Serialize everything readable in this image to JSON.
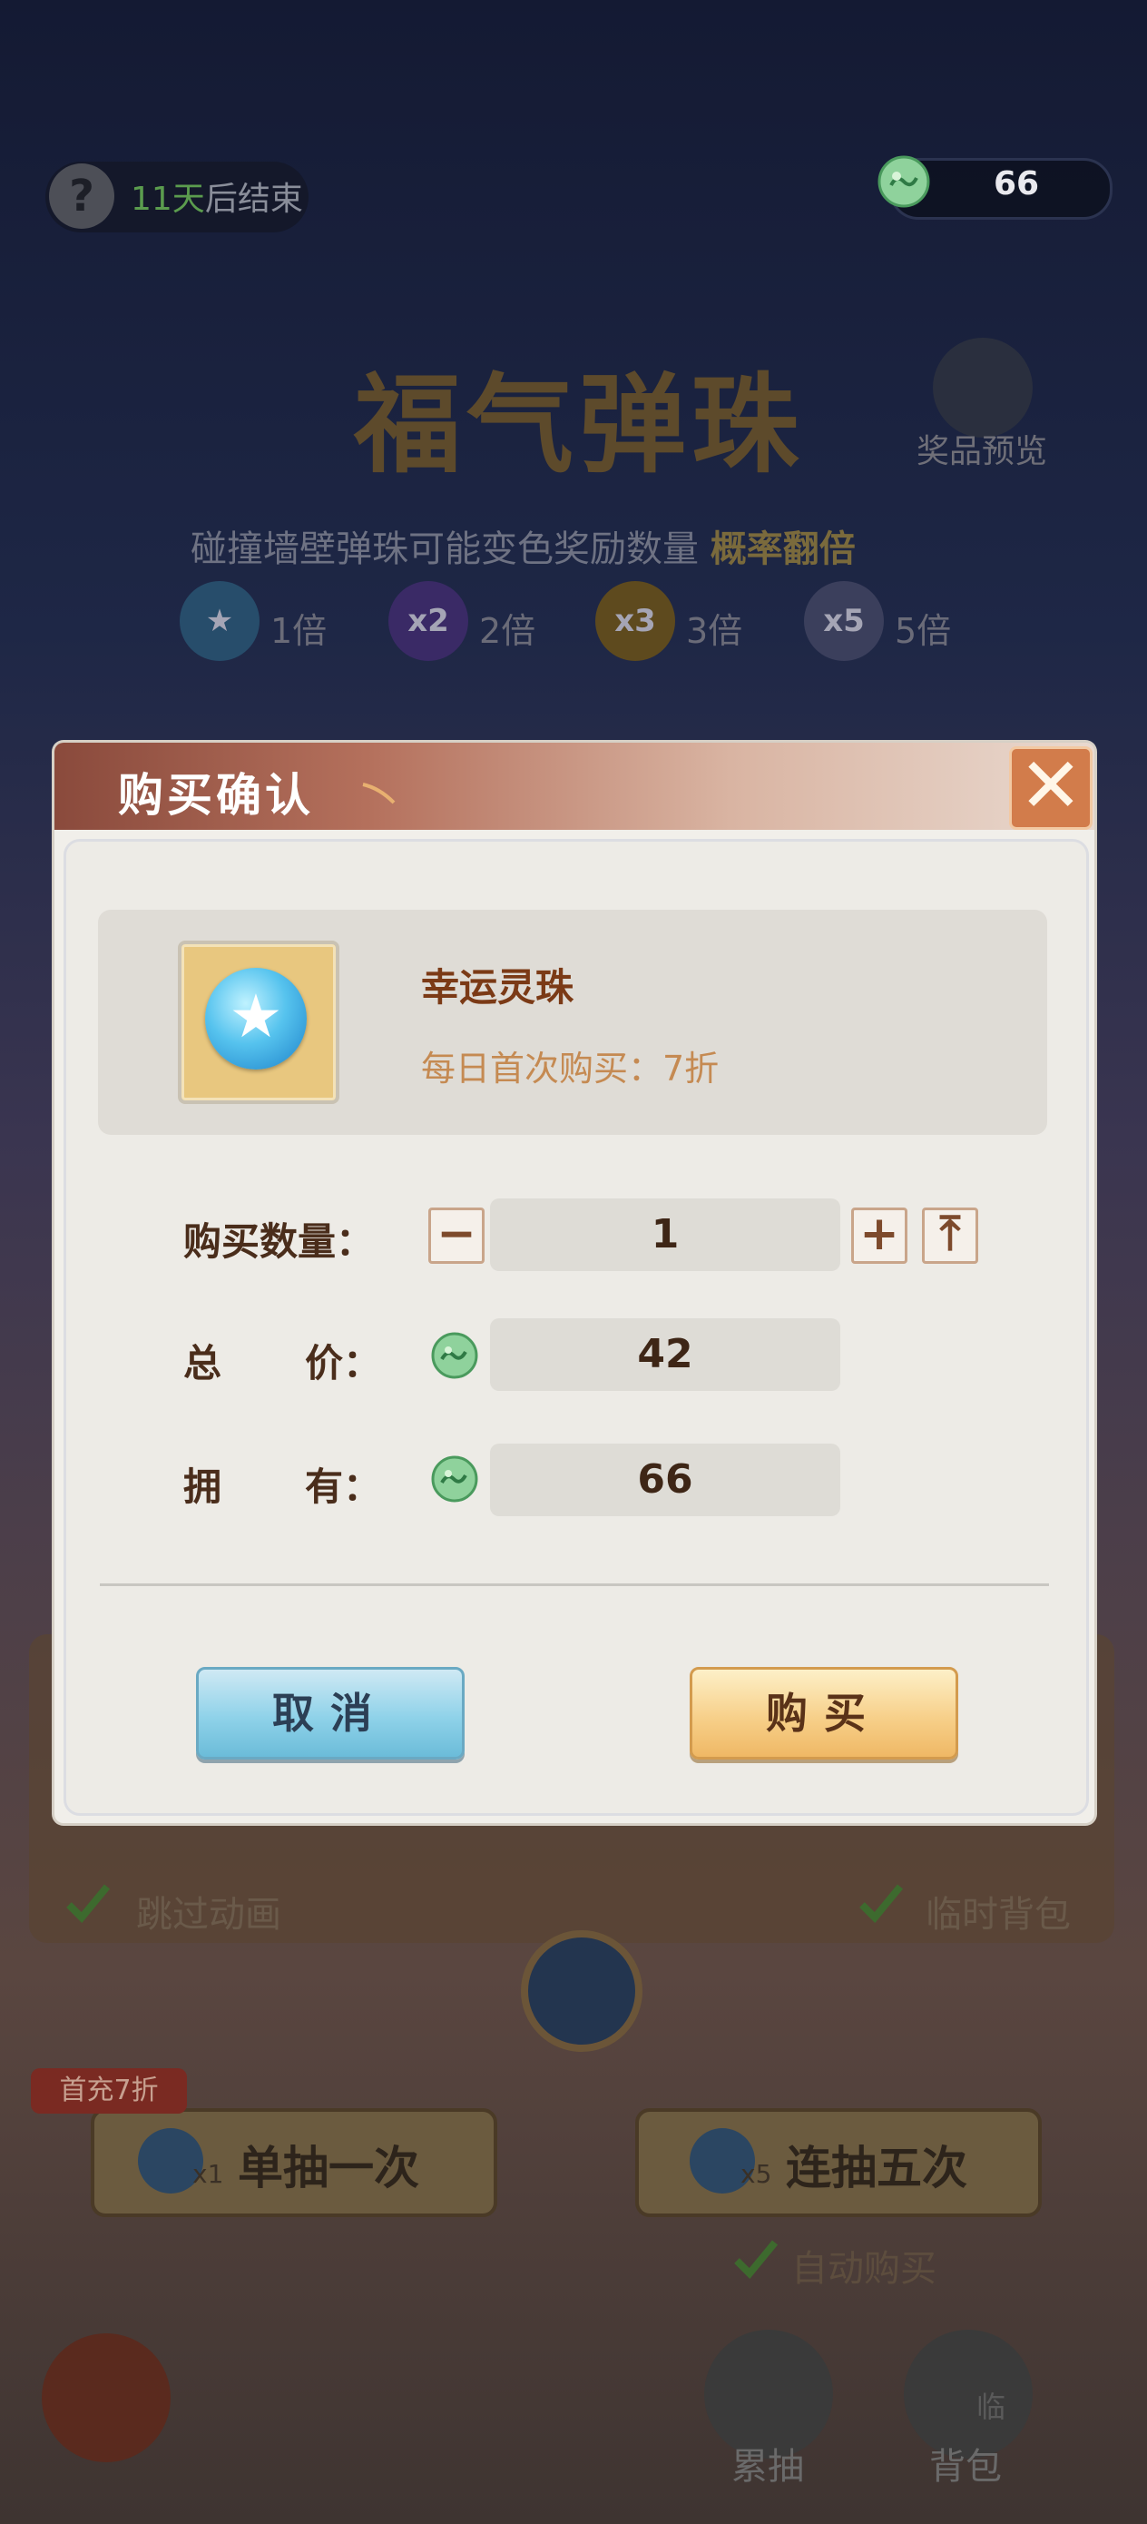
{
  "top_bar": {
    "help_icon": "?",
    "timer_days": "11天",
    "timer_suffix": "后结束",
    "currency_icon": "jade-cloud-coin-icon",
    "currency_value": "66"
  },
  "event": {
    "title": "福气弹珠",
    "prize_preview_label": "奖品预览",
    "subtitle_prefix": "碰撞墙壁弹珠可能变色奖励数量",
    "subtitle_highlight": "概率翻倍",
    "multipliers": [
      {
        "ball": "",
        "label": "1倍"
      },
      {
        "ball": "x2",
        "label": "2倍"
      },
      {
        "ball": "x3",
        "label": "3倍"
      },
      {
        "ball": "x5",
        "label": "5倍"
      }
    ]
  },
  "options": {
    "skip_animation": "跳过动画",
    "temp_bag": "临时背包"
  },
  "draw": {
    "promo_tag": "首充7折",
    "single_label": "单抽一次",
    "single_count": "x1",
    "five_label": "连抽五次",
    "five_count": "x5",
    "auto_buy": "自动购买"
  },
  "bottom_nav": {
    "cumulative": "累抽",
    "bag": "背包",
    "bag_badge": "临"
  },
  "dialog": {
    "title": "购买确认",
    "close_icon": "✕",
    "item": {
      "name": "幸运灵珠",
      "discount_text": "每日首次购买：7折"
    },
    "quantity_label": "购买数量：",
    "quantity_value": "1",
    "minus": "−",
    "plus": "+",
    "max": "⤒",
    "total_label_1": "总",
    "total_label_2": "价：",
    "total_value": "42",
    "owned_label_1": "拥",
    "owned_label_2": "有：",
    "owned_value": "66",
    "cancel_label": "取消",
    "buy_label": "购买"
  },
  "colors": {
    "dialog_header": "#b4705c",
    "close_button": "#d27c4b",
    "cancel_button": "#8fd2e9",
    "buy_button": "#f7d08a",
    "item_name": "#7b3a16",
    "discount_text": "#c58a52"
  }
}
